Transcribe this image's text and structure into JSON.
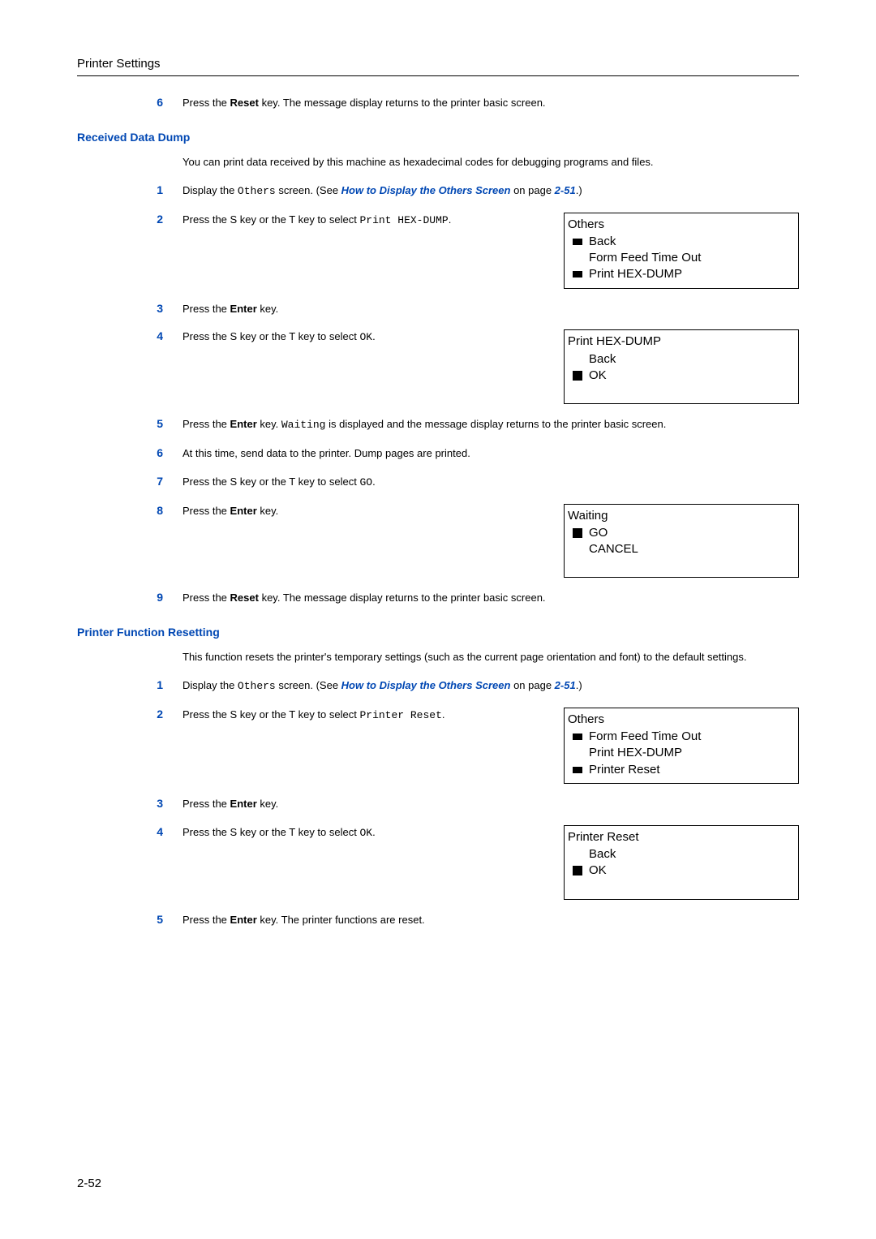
{
  "header": {
    "title": "Printer Settings"
  },
  "page_number": "2-52",
  "top_step": {
    "num": "6",
    "parts": {
      "p1": "Press the ",
      "p2": "Reset",
      "p3": " key. The message display returns to the printer basic screen."
    }
  },
  "section1": {
    "heading": "Received Data Dump",
    "intro": "You can print data received by this machine as hexadecimal codes for debugging programs and files.",
    "s1": {
      "num": "1",
      "p1": "Display the ",
      "code1": "Others",
      "p2": " screen. (See ",
      "linktext": "How to Display the Others Screen",
      "p3": " on page ",
      "pref": "2-51",
      "p4": ".)"
    },
    "s2": {
      "num": "2",
      "p1": "Press the  S key or the  T key to select ",
      "code1": "Print HEX-DUMP",
      "p2": ".",
      "lcd": {
        "title": "Others",
        "i1": "Back",
        "i2": "Form Feed Time Out",
        "i3": "Print HEX-DUMP"
      }
    },
    "s3": {
      "num": "3",
      "p1": "Press the ",
      "p2": "Enter",
      "p3": " key."
    },
    "s4": {
      "num": "4",
      "p1": "Press the  S key or the  T key to select ",
      "code1": "OK",
      "p2": ".",
      "lcd": {
        "title": "Print HEX-DUMP",
        "i1": "Back",
        "i2": "OK"
      }
    },
    "s5": {
      "num": "5",
      "p1": "Press the ",
      "p2": "Enter",
      "p3": " key. ",
      "code1": "Waiting",
      "p4": " is displayed and the message display returns to the printer basic screen."
    },
    "s6": {
      "num": "6",
      "text": "At this time, send data to the printer. Dump pages are printed."
    },
    "s7": {
      "num": "7",
      "p1": "Press the  S key or the  T key to select ",
      "code1": "GO",
      "p2": "."
    },
    "s8": {
      "num": "8",
      "p1": "Press the ",
      "p2": "Enter",
      "p3": " key.",
      "lcd": {
        "title": "Waiting",
        "i1": "GO",
        "i2": "CANCEL"
      }
    },
    "s9": {
      "num": "9",
      "p1": "Press the ",
      "p2": "Reset",
      "p3": " key. The message display returns to the printer basic screen."
    }
  },
  "section2": {
    "heading": "Printer Function Resetting",
    "intro": "This function resets the printer's temporary settings (such as the current page orientation and font) to the default settings.",
    "s1": {
      "num": "1",
      "p1": "Display the ",
      "code1": "Others",
      "p2": " screen. (See ",
      "linktext": "How to Display the Others Screen",
      "p3": " on page ",
      "pref": "2-51",
      "p4": ".)"
    },
    "s2": {
      "num": "2",
      "p1": "Press the  S key or the  T key to select ",
      "code1": "Printer Reset",
      "p2": ".",
      "lcd": {
        "title": "Others",
        "i1": "Form Feed Time Out",
        "i2": "Print HEX-DUMP",
        "i3": "Printer Reset"
      }
    },
    "s3": {
      "num": "3",
      "p1": "Press the ",
      "p2": "Enter",
      "p3": " key."
    },
    "s4": {
      "num": "4",
      "p1": "Press the  S key or the  T key to select ",
      "code1": "OK",
      "p2": ".",
      "lcd": {
        "title": "Printer Reset",
        "i1": "Back",
        "i2": "OK"
      }
    },
    "s5": {
      "num": "5",
      "p1": "Press the ",
      "p2": "Enter",
      "p3": " key. The printer functions are reset."
    }
  }
}
